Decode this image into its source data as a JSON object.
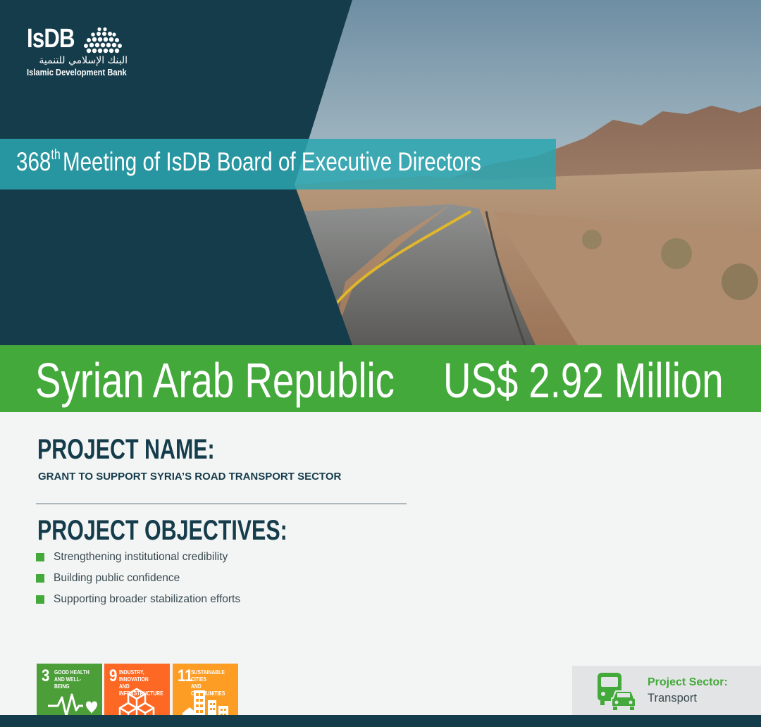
{
  "header": {
    "logo_mark": "IsDB",
    "logo_arabic": "البنك الإسلامي للتنمية",
    "logo_english": "Islamic Development Bank",
    "meeting_number": "368",
    "meeting_ordinal": "th",
    "meeting_rest": "Meeting of IsDB Board of Executive Directors"
  },
  "banner": {
    "country": "Syrian Arab Republic",
    "amount": "US$ 2.92 Million"
  },
  "project": {
    "name_heading": "PROJECT NAME:",
    "name": "GRANT TO SUPPORT SYRIA’S ROAD TRANSPORT SECTOR",
    "objectives_heading": "PROJECT OBJECTIVES:",
    "objectives": [
      "Strengthening institutional credibility",
      "Building public confidence",
      "Supporting broader stabilization efforts"
    ]
  },
  "sdgs": [
    {
      "number": "3",
      "label": "GOOD HEALTH\nAND WELL-BEING",
      "color": "#4c9f38",
      "icon": "heartbeat-icon"
    },
    {
      "number": "9",
      "label": "INDUSTRY, INNOVATION\nAND INFRASTRUCTURE",
      "color": "#fd6925",
      "icon": "cubes-icon"
    },
    {
      "number": "11",
      "label": "SUSTAINABLE CITIES\nAND COMMUNITIES",
      "color": "#fd9d24",
      "icon": "city-buildings-icon"
    }
  ],
  "sector": {
    "label": "Project Sector:",
    "value": "Transport",
    "icon": "bus-car-icon"
  },
  "colors": {
    "navy": "#153c4b",
    "teal": "#2ba5b0",
    "green": "#44a93b"
  }
}
